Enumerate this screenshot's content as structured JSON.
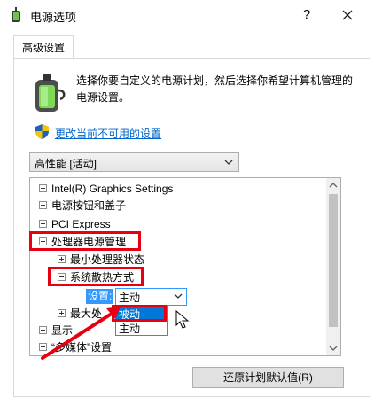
{
  "window": {
    "title": "电源选项",
    "help_label": "?",
    "icon": "power-options-icon"
  },
  "tab": {
    "label": "高级设置"
  },
  "description": "选择你要自定义的电源计划，然后选择你希望计算机管理的电源设置。",
  "change_link": "更改当前不可用的设置",
  "plan_select": {
    "value": "高性能 [活动]"
  },
  "tree": {
    "items": [
      {
        "label": "Intel(R) Graphics Settings"
      },
      {
        "label": "电源按钮和盖子"
      },
      {
        "label": "PCI Express"
      },
      {
        "label": "处理器电源管理"
      },
      {
        "label": "最小处理器状态"
      },
      {
        "label": "系统散热方式"
      },
      {
        "label": "最大处"
      },
      {
        "label": "显示"
      },
      {
        "label": "“多媒体”设置"
      }
    ],
    "setting_label": "设置:",
    "setting_value": "主动",
    "dropdown_options": [
      {
        "label": "被动",
        "selected": true
      },
      {
        "label": "主动",
        "selected": false
      }
    ]
  },
  "restore_button": "还原计划默认值(R)",
  "colors": {
    "highlight_box": "#e60012",
    "selection": "#0078d7",
    "link": "#0066cc"
  }
}
